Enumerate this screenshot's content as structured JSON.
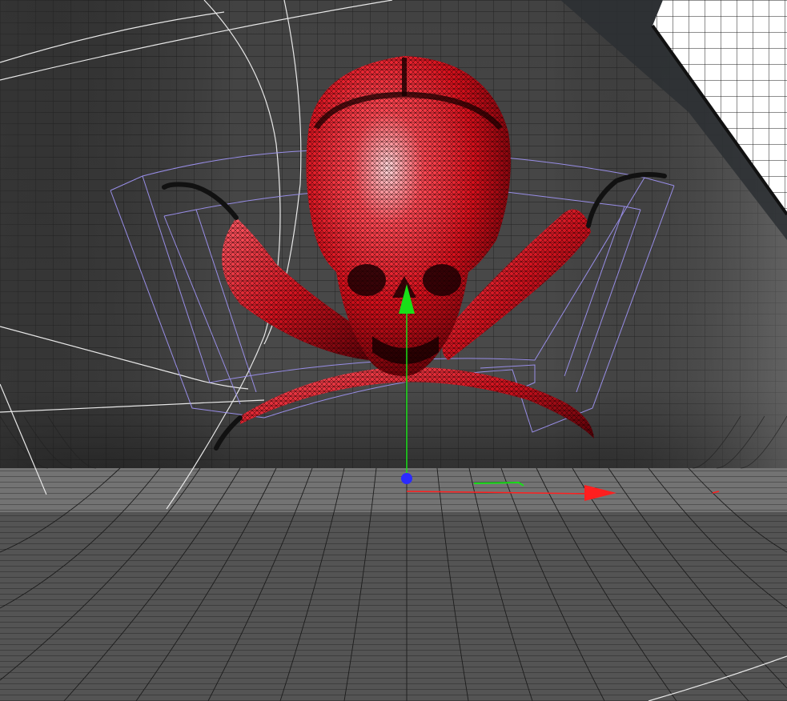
{
  "viewport": {
    "kind": "3d-perspective-viewport",
    "render_mode": "wireframe-on-shaded",
    "background_color": "#3a3a3a"
  },
  "scene": {
    "model": "skull-and-crossed-chili-peppers",
    "model_color": "#e0101a",
    "wire_color": "#1a0000",
    "selection_box_color": "#9d92f0",
    "backdrop_grid_color": "#141414",
    "softbox_light_color": "#ffffff",
    "spline_color": "#e8e8e8"
  },
  "gizmo": {
    "type": "move-axes",
    "x_axis_color": "#ff1f1f",
    "y_axis_color": "#18e018",
    "z_axis_color": "#2b2bff"
  }
}
